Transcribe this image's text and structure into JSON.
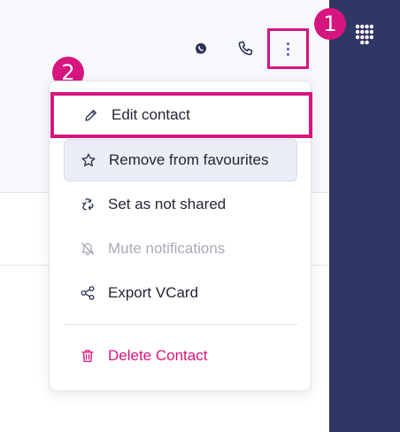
{
  "header": {
    "whatsapp_icon": "whatsapp-icon",
    "phone_icon": "phone-icon",
    "more_icon": "more-vertical-icon"
  },
  "sidebar": {
    "keypad_icon": "keypad-icon"
  },
  "steps": {
    "first": "1",
    "second": "2"
  },
  "menu": {
    "items": [
      {
        "label": "Edit contact",
        "icon": "pencil-icon"
      },
      {
        "label": "Remove from favourites",
        "icon": "star-icon"
      },
      {
        "label": "Set as not shared",
        "icon": "share-nodes-icon"
      },
      {
        "label": "Mute notifications",
        "icon": "bell-off-icon",
        "disabled": true
      },
      {
        "label": "Export VCard",
        "icon": "export-share-icon"
      },
      {
        "label": "Delete Contact",
        "icon": "trash-icon"
      }
    ]
  },
  "colors": {
    "accent": "#d6157e",
    "rail": "#303764",
    "dots": "#5b4fe0",
    "disabled_text": "#a7abb7"
  }
}
